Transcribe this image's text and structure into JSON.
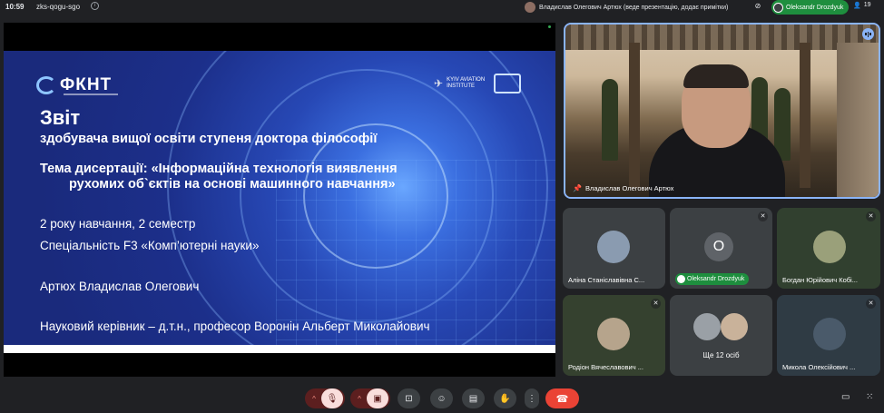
{
  "topbar": {
    "time": "10:59",
    "meeting_code": "zks-qogu-sgo",
    "presenter_notice": "Владислав Олегович Артюх (веде презентацію, додає примітки)",
    "active_speaker": "Oleksandr Drozdyuk",
    "participant_count": "19"
  },
  "slide": {
    "logo": "ФКНТ",
    "institute": "KYIV AVIATION INSTITUTE",
    "title": "Звіт",
    "subtitle": "здобувача вищої освіти ступеня доктора філософії",
    "topic_line1": "Тема дисертації: «Інформаційна технологія виявлення",
    "topic_line2": "рухомих об`єктів на основі машинного навчання»",
    "year": "2 року навчання, 2 семестр",
    "specialty": "Спеціальність F3 «Комп’ютерні науки»",
    "author": "Артюх Владислав Олегович",
    "supervisor": "Науковий керівник – д.т.н., професор Воронін Альберт Миколайович"
  },
  "main_tile": {
    "name": "Владислав Олегович Артюх"
  },
  "participants": [
    {
      "name": "Аліна Станіславівна С...",
      "muted": false,
      "avatar_color": "#8a9bb0"
    },
    {
      "name": "Oleksandr Drozdyuk",
      "initial": "O",
      "muted": true,
      "avatar_color": "#5f6368"
    },
    {
      "name": "Богдан Юрійович Кобі...",
      "muted": true,
      "avatar_color": "#9aa07a"
    },
    {
      "name": "Родіон Вячеславович ...",
      "muted": true,
      "avatar_color": "#b6a48c"
    },
    {
      "more_label": "Ще 12 осіб"
    },
    {
      "name": "Микола Олексійович ...",
      "muted": true,
      "avatar_color": "#4a5a6a"
    }
  ],
  "icons": {
    "mic": "mic-off-icon",
    "camera": "camera-off-icon",
    "present": "present-icon",
    "emoji": "emoji-icon",
    "captions": "captions-icon",
    "hand": "raise-hand-icon",
    "more": "more-vert-icon",
    "end_call": "end-call-icon",
    "chat": "chat-icon",
    "activities": "activities-icon"
  },
  "colors": {
    "accent": "#8ab4f8",
    "speaker_green": "#1e8e3e",
    "end_call": "#ea4335"
  }
}
